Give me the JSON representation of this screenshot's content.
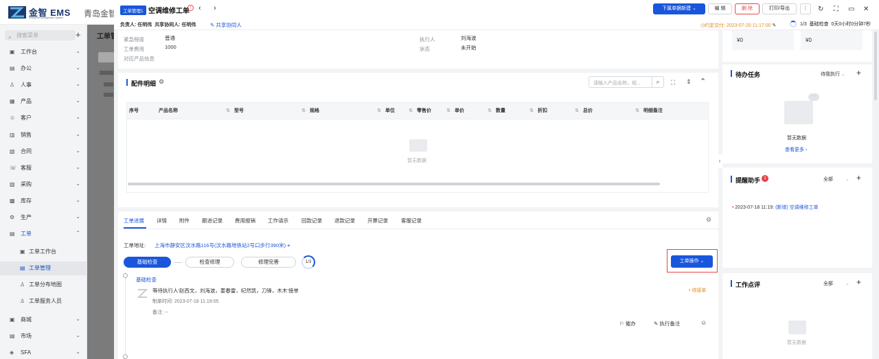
{
  "app": {
    "logo_text": "金智 EMS",
    "logo_sub": "Enterprise Management System",
    "company": "青岛金智",
    "search_placeholder": "搜索菜单"
  },
  "nav": {
    "items": [
      {
        "label": "工作台",
        "icon": "▣"
      },
      {
        "label": "办公",
        "icon": "▤"
      },
      {
        "label": "人事",
        "icon": "♙"
      },
      {
        "label": "产品",
        "icon": "▦"
      },
      {
        "label": "客户",
        "icon": "☺"
      },
      {
        "label": "销售",
        "icon": "▥"
      },
      {
        "label": "合同",
        "icon": "▧"
      },
      {
        "label": "客服",
        "icon": "☏"
      },
      {
        "label": "采购",
        "icon": "▨"
      },
      {
        "label": "库存",
        "icon": "▩"
      },
      {
        "label": "生产",
        "icon": "⚙"
      },
      {
        "label": "工单",
        "icon": "▤"
      }
    ],
    "sub": [
      {
        "label": "工单工作台"
      },
      {
        "label": "工单管理"
      },
      {
        "label": "工单分布地图"
      },
      {
        "label": "工单服务人员"
      }
    ],
    "more": [
      {
        "label": "商城",
        "icon": "▣"
      },
      {
        "label": "市场",
        "icon": "▤"
      },
      {
        "label": "SFA",
        "icon": "◈"
      }
    ]
  },
  "bgpage": {
    "title": "工单管"
  },
  "header": {
    "tag": "工单管理1",
    "title": "空调维修工单",
    "owner_label": "负责人:",
    "owner": "任明伟",
    "collab_label": "共享协同人:",
    "collab": "任明伟",
    "share_link": "共享协同人",
    "btn_new": "下属单据新建",
    "btn_edit": "编 辑",
    "btn_delete": "删 除",
    "btn_print": "打印/导出",
    "deadline": "约定交付: 2023-07-20 11:17:00",
    "stage_progress": "1/3",
    "stage_name": "基础检查",
    "elapsed": "0天0小时0分钟7秒"
  },
  "info": {
    "rows": [
      {
        "label": "紧急程度",
        "value": "普通"
      },
      {
        "label": "工单费用",
        "value": "1000"
      },
      {
        "label": "对应产品信息",
        "value": ""
      }
    ],
    "right": [
      {
        "label": "执行人",
        "value": "刘海波"
      },
      {
        "label": "状态",
        "value": "未开始"
      }
    ]
  },
  "parts": {
    "title": "配件明细",
    "search_placeholder": "请输入产品名称，规...",
    "columns": [
      "序号",
      "产品名称",
      "型号",
      "规格",
      "单位",
      "零售价",
      "单价",
      "数量",
      "折扣",
      "总价",
      "明细备注"
    ],
    "empty": "暂无数据"
  },
  "tabs": [
    "工单进展",
    "详情",
    "附件",
    "跟进记录",
    "费用报销",
    "工作请示",
    "回款记录",
    "退款记录",
    "开票记录",
    "客服记录"
  ],
  "progress": {
    "address_label": "工单地址:",
    "address": "上海市静安区汶水路116号(汶水路地铁站2号口步行390米)",
    "steps": [
      "基础检查",
      "检查修理",
      "修理完善"
    ],
    "step_count": "1/3",
    "op_button": "工单操作",
    "timeline_title": "基础检查",
    "entry_text": "等待执行人'赵西文，刘海波，姜春雷，纪然凯，刀锋，木木'接单",
    "entry_status": "待接单",
    "entry_time": "制单时间: 2023-07-18 11:19:05",
    "entry_note": "备注: --",
    "act_urge": "催办",
    "act_note": "执行备注"
  },
  "right": {
    "amounts": [
      "¥0",
      "¥0"
    ],
    "todo": {
      "title": "待办任务",
      "filter": "待我执行",
      "empty": "暂无数据",
      "more": "查看更多"
    },
    "remind": {
      "title": "提醒助手",
      "badge": "1",
      "filter": "全部",
      "entry": "2023-07-18 11:19:",
      "entry_tag": "(新增)",
      "entry_link": "空调维修工单"
    },
    "review": {
      "title": "工作点评",
      "filter": "全部",
      "empty": "暂无数据"
    }
  },
  "colors": {
    "primary": "#1a56db",
    "danger": "#e64545",
    "warning": "#e48a1c"
  }
}
